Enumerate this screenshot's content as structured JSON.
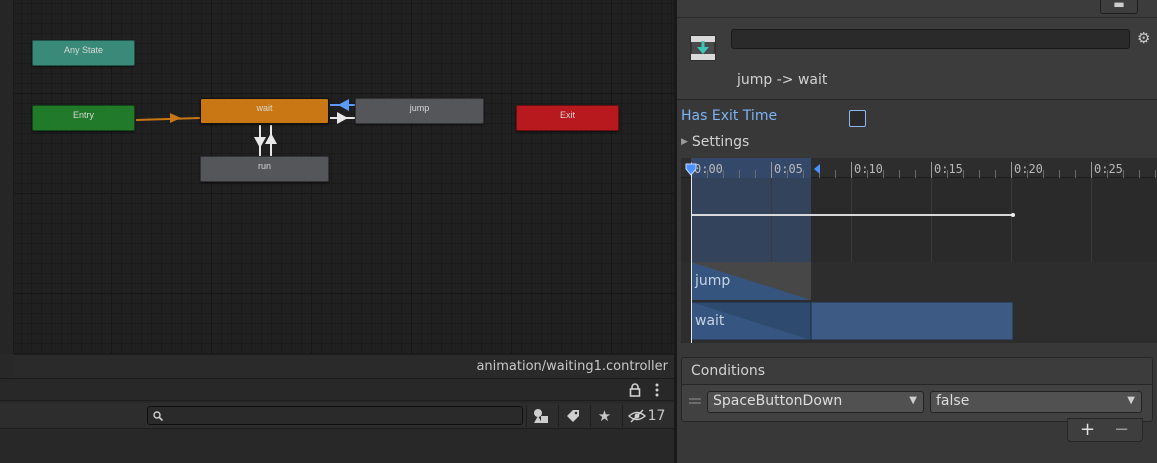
{
  "graph": {
    "nodes": {
      "any_state": {
        "label": "Any State",
        "color": "#3a8a7a"
      },
      "entry": {
        "label": "Entry",
        "color": "#217a2a"
      },
      "wait": {
        "label": "wait",
        "color": "#c87714"
      },
      "jump": {
        "label": "jump",
        "color": "#555659"
      },
      "run": {
        "label": "run",
        "color": "#555659"
      },
      "exit": {
        "label": "Exit",
        "color": "#b8191e"
      }
    },
    "footer_path": "animation/waiting1.controller",
    "selected_transition_color": "#5b9bff"
  },
  "project_toolbar": {
    "search_placeholder": "",
    "search_icon": "search-icon",
    "hidden_count": "17"
  },
  "inspector": {
    "transition_name": "jump -> wait",
    "has_exit_time_label": "Has Exit Time",
    "has_exit_time_checked": false,
    "settings_label": "Settings",
    "timeline": {
      "ticks": [
        "0:00",
        "0:05",
        "0:10",
        "0:15",
        "0:20",
        "0:25"
      ],
      "tracks": [
        {
          "label": "jump"
        },
        {
          "label": "wait"
        }
      ]
    },
    "conditions": {
      "title": "Conditions",
      "parameter": "SpaceButtonDown",
      "value": "false",
      "add_label": "+",
      "remove_label": "−"
    }
  }
}
